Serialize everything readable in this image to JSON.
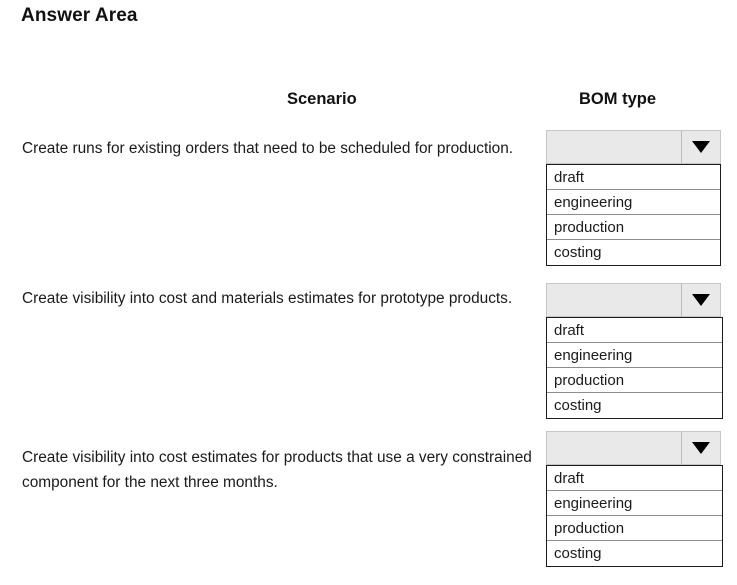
{
  "page": {
    "title": "Answer Area"
  },
  "headers": {
    "scenario": "Scenario",
    "bom_type": "BOM type"
  },
  "colors": {
    "combo_fill": "#e9e9e9",
    "combo_border": "#c6c6c6",
    "list_border": "#1c1c1c",
    "row_divider": "#8d8d8d",
    "text": "#1a1a1a",
    "background": "#ffffff"
  },
  "icons": {
    "dropdown_arrow": "chevron-down-icon"
  },
  "rows": [
    {
      "scenario": "Create runs for existing orders that need to be scheduled for production.",
      "dropdown": {
        "selected": "",
        "placeholder": "",
        "expanded": true,
        "options": [
          "draft",
          "engineering",
          "production",
          "costing"
        ]
      }
    },
    {
      "scenario": "Create visibility into cost and materials estimates for prototype products.",
      "dropdown": {
        "selected": "",
        "placeholder": "",
        "expanded": true,
        "options": [
          "draft",
          "engineering",
          "production",
          "costing"
        ]
      }
    },
    {
      "scenario": "Create visibility into cost estimates for products that use a very constrained component for the next three months.",
      "dropdown": {
        "selected": "",
        "placeholder": "",
        "expanded": true,
        "options": [
          "draft",
          "engineering",
          "production",
          "costing"
        ]
      }
    }
  ]
}
